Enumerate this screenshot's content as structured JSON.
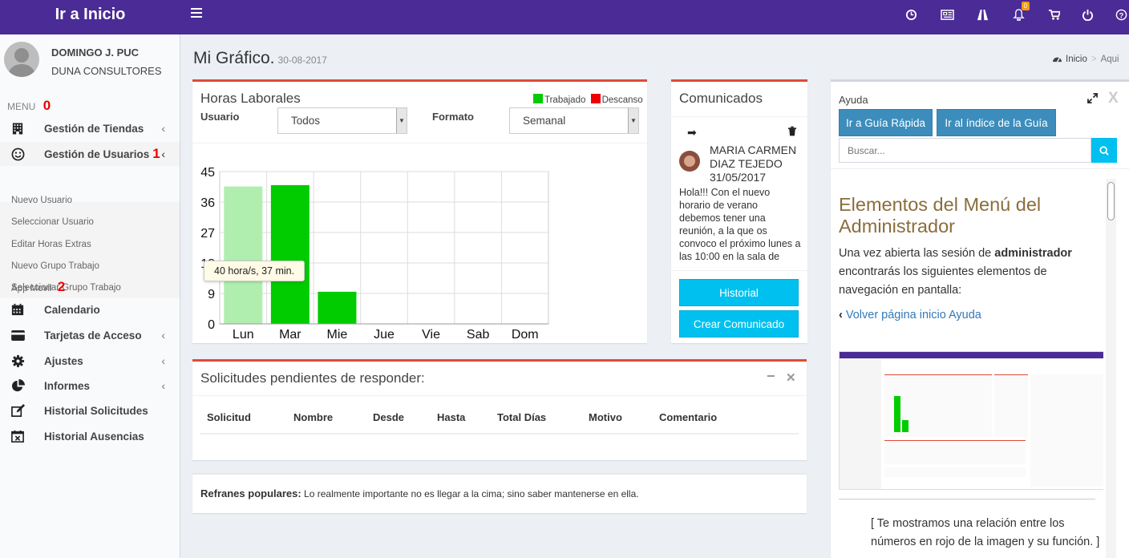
{
  "header": {
    "brand": "Ir a Inicio",
    "notification_count": "0"
  },
  "user": {
    "name": "DOMINGO J. PUC",
    "company": "DUNA CONSULTORES"
  },
  "menu": {
    "header": "MENU",
    "header_marker": "0",
    "items": [
      {
        "label": "Gestión de Tiendas",
        "icon": "building-icon"
      },
      {
        "label": "Gestión de Usuarios",
        "icon": "smile-icon",
        "marker": "1"
      },
      {
        "label": "Calendario",
        "icon": "calendar-icon"
      },
      {
        "label": "Tarjetas de Acceso",
        "icon": "credit-card-icon"
      },
      {
        "label": "Ajustes",
        "icon": "gear-icon"
      },
      {
        "label": "Informes",
        "icon": "pie-chart-icon"
      },
      {
        "label": "Historial Solicitudes",
        "icon": "edit-icon"
      },
      {
        "label": "Historial Ausencias",
        "icon": "calendar-x-icon"
      }
    ],
    "subitems": [
      {
        "label": "Nuevo Usuario"
      },
      {
        "label": "Seleccionar Usuario"
      },
      {
        "label": "Editar Horas Extras"
      },
      {
        "label": "Nuevo Grupo Trabajo"
      },
      {
        "label": "Seleccionar Grupo Trabajo"
      },
      {
        "label": "App Movil",
        "marker": "2"
      }
    ]
  },
  "page": {
    "title": "Mi Gráfico.",
    "date": "30-08-2017"
  },
  "breadcrumb": {
    "home": "Inicio",
    "current": "Aqui"
  },
  "hours_box": {
    "title": "Horas Laborales",
    "legend_worked": "Trabajado",
    "legend_rest": "Descanso",
    "user_label": "Usuario",
    "user_value": "Todos",
    "format_label": "Formato",
    "format_value": "Semanal",
    "tooltip": "40 hora/s, 37 min."
  },
  "chart_data": {
    "type": "bar",
    "categories": [
      "Lun",
      "Mar",
      "Mie",
      "Jue",
      "Vie",
      "Sab",
      "Dom"
    ],
    "series": [
      {
        "name": "Trabajado",
        "values": [
          40.6,
          41,
          9.5,
          0,
          0,
          0,
          0
        ]
      }
    ],
    "yticks": [
      "0",
      "9",
      "18",
      "27",
      "36",
      "45"
    ],
    "ylim": [
      0,
      45
    ],
    "grid": true,
    "colors": {
      "worked": "#00cc00",
      "worked_highlight": "#b0eeb0",
      "rest": "#ee0000"
    }
  },
  "comunicados": {
    "title": "Comunicados",
    "author_line1": "MARIA CARMEN",
    "author_line2": "DIAZ TEJEDO",
    "date": "31/05/2017",
    "message": "Hola!!! Con el nuevo horario de verano debemos tener una reunión, a la que os convoco el próximo lunes a las 10:00 en la sala de",
    "historial_button": "Historial",
    "create_button": "Crear Comunicado"
  },
  "solicitudes": {
    "title": "Solicitudes pendientes de responder:",
    "columns": [
      "Solicitud",
      "Nombre",
      "Desde",
      "Hasta",
      "Total Días",
      "Motivo",
      "Comentario"
    ]
  },
  "refranes": {
    "label": "Refranes populares:",
    "text": "Lo realmente importante no es llegar a la cima; sino saber mantenerse en ella."
  },
  "ayuda": {
    "title": "Ayuda",
    "close": "X",
    "quick_guide_button": "Ir a Guía Rápida",
    "index_button": "Ir al índice de la Guía",
    "search_placeholder": "Buscar...",
    "heading": "Elementos del Menú del Administrador",
    "intro_pre": "Una vez abierta las sesión de ",
    "intro_bold": "administrador",
    "intro_post": " encontrarás los siguientes elementos de navegación en pantalla:",
    "back_link": "Volver página inicio Ayuda",
    "relation_text": "[ Te mostramos una relación entre los números en rojo de la imagen y su función. ]"
  },
  "colors": {
    "topbar": "#4b2b96",
    "accent_blue": "#3c8dbc",
    "cyan": "#00c0ef",
    "red_border": "#dd4b39"
  }
}
